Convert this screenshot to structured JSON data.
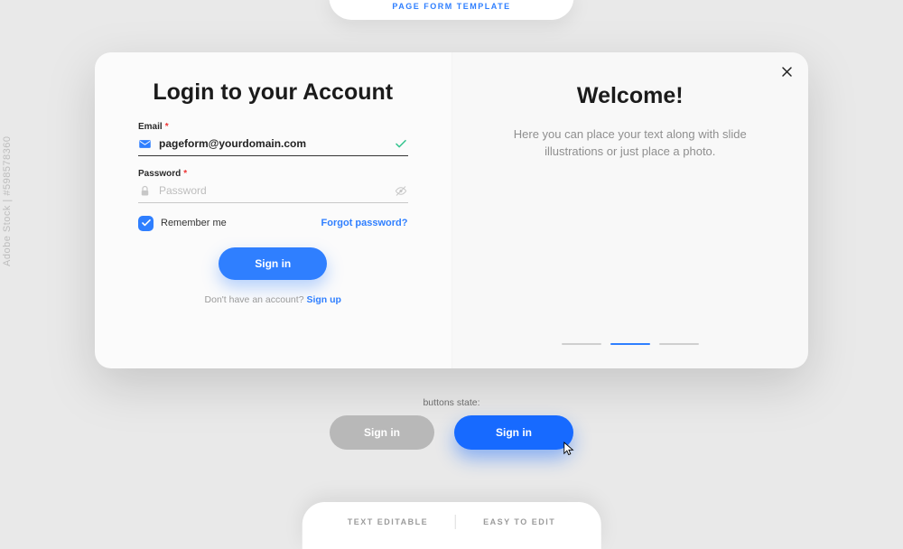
{
  "header": {
    "tag": "PAGE FORM TEMPLATE"
  },
  "login": {
    "title": "Login to your Account",
    "email_label": "Email",
    "email_value": "pageform@yourdomain.com",
    "password_label": "Password",
    "password_placeholder": "Password",
    "remember_label": "Remember me",
    "forgot_label": "Forgot password?",
    "signin_label": "Sign in",
    "signup_prompt": "Don't have an account? ",
    "signup_link": "Sign up"
  },
  "welcome": {
    "title": "Welcome!",
    "subtitle": "Here you can place your text along with slide illustrations or just place a photo."
  },
  "states": {
    "label": "buttons state:",
    "disabled": "Sign in",
    "hover": "Sign in"
  },
  "footer": {
    "left": "TEXT EDITABLE",
    "right": "EASY TO EDIT"
  },
  "watermark": "Adobe Stock | #598578360",
  "colors": {
    "accent": "#2f7fff"
  }
}
